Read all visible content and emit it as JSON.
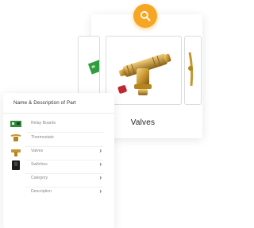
{
  "search": {
    "icon": "search-icon",
    "accent": "#f6a623"
  },
  "carousel": {
    "selected_label": "Valves",
    "tiles": [
      {
        "name": "relay-board",
        "icon": "circuit-board-image"
      },
      {
        "name": "brass-valve",
        "icon": "brass-valve-image"
      },
      {
        "name": "thermostat",
        "icon": "thermostat-image"
      }
    ]
  },
  "menu": {
    "title": "Name & Description of Part",
    "items": [
      {
        "label": "Relay Boards",
        "chevron": ""
      },
      {
        "label": "Thermostats",
        "chevron": ""
      },
      {
        "label": "Valves",
        "chevron": "›"
      },
      {
        "label": "Switches",
        "chevron": "›"
      },
      {
        "label": "Category",
        "chevron": "›"
      },
      {
        "label": "Description",
        "chevron": "›"
      }
    ]
  }
}
